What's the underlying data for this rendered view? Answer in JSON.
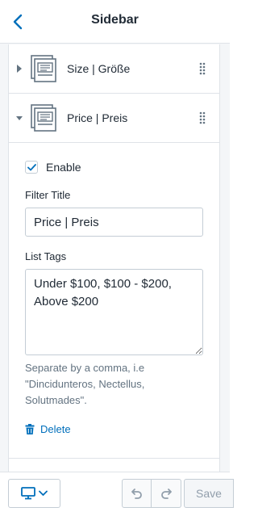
{
  "header": {
    "title": "Sidebar",
    "back_icon": "chevron-left-icon"
  },
  "blocks": [
    {
      "label": "Size | Größe",
      "expanded": false,
      "icon": "block-layout-icon"
    },
    {
      "label": "Price | Preis",
      "expanded": true,
      "icon": "block-layout-icon"
    }
  ],
  "settings": {
    "enable_label": "Enable",
    "enable_checked": true,
    "filter_title_label": "Filter Title",
    "filter_title_value": "Price | Preis",
    "list_tags_label": "List Tags",
    "list_tags_value": "Under $100, $100 - $200, Above $200",
    "help_text": "Separate by a comma, i.e \"Dincidunteros, Nectellus, Solutmades\".",
    "delete_label": "Delete"
  },
  "footer": {
    "device_icon": "desktop-icon",
    "save_label": "Save"
  },
  "colors": {
    "accent": "#006fbb",
    "border": "#c4cdd5",
    "muted": "#637381",
    "heading": "#212b36"
  }
}
